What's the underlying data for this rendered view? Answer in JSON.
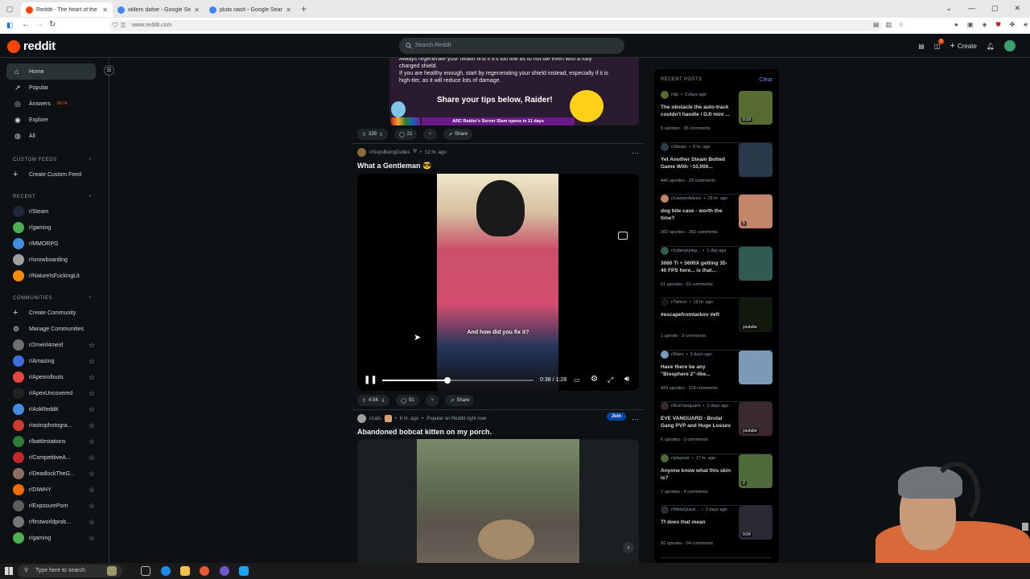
{
  "browser": {
    "tabs": [
      {
        "title": "Reddit - The heart of the in",
        "color": "#ff4500"
      },
      {
        "title": "willem dafoe - Google Search",
        "color": "#4285f4"
      },
      {
        "title": "pluto nash - Google Search",
        "color": "#4285f4"
      }
    ],
    "url": "www.reddit.com"
  },
  "header": {
    "logo": "reddit",
    "search_placeholder": "Search Reddit",
    "create_label": "Create",
    "notif_count": "1"
  },
  "sidebar": {
    "nav": [
      {
        "label": "Home"
      },
      {
        "label": "Popular"
      },
      {
        "label": "Answers",
        "badge": "BETA"
      },
      {
        "label": "Explore"
      },
      {
        "label": "All"
      }
    ],
    "custom_feeds_title": "CUSTOM FEEDS",
    "create_feed": "Create Custom Feed",
    "recent_title": "RECENT",
    "recent": [
      {
        "label": "r/Steam",
        "color": "#1b2838"
      },
      {
        "label": "r/gaming",
        "color": "#4caf50"
      },
      {
        "label": "r/MMORPG",
        "color": "#3f8ee0"
      },
      {
        "label": "r/snowboarding",
        "color": "#9e9e9e"
      },
      {
        "label": "r/NatureIsFuckingLit",
        "color": "#ff8c00"
      }
    ],
    "communities_title": "COMMUNITIES",
    "create_community": "Create Community",
    "manage_communities": "Manage Communities",
    "communities": [
      {
        "label": "r/2meirl4meirl",
        "color": "#6e6e6e"
      },
      {
        "label": "r/Amazing",
        "color": "#3d6ee0"
      },
      {
        "label": "r/Apexrollouts",
        "color": "#e8453c"
      },
      {
        "label": "r/ApexUncovered",
        "color": "#222"
      },
      {
        "label": "r/AskReddit",
        "color": "#3f8ee0"
      },
      {
        "label": "r/astrophotogra...",
        "color": "#cc3b2b"
      },
      {
        "label": "r/battlestations",
        "color": "#2e7d32"
      },
      {
        "label": "r/CompetitiveA...",
        "color": "#c62828"
      },
      {
        "label": "r/DeadlockTheG...",
        "color": "#8d6e63"
      },
      {
        "label": "r/DIWHY",
        "color": "#ef6c00"
      },
      {
        "label": "r/ExposurePorn",
        "color": "#5d5d5d"
      },
      {
        "label": "r/firstworldprob...",
        "color": "#777"
      },
      {
        "label": "r/gaming",
        "color": "#4caf50"
      }
    ]
  },
  "feed": {
    "banner": {
      "line1": "Always regenerate your health first if it's too low as to not die even with a fully charged shield.",
      "line2": "If you are healthy enough, start by regenerating your shield instead, especially if it is high-tier, as it will reduce lots of damage.",
      "cta": "Share your tips below, Raider!",
      "footer": "ARC Raider's Server Slam opens in 11 days"
    },
    "post0": {
      "upvotes": "339",
      "comments": "21",
      "share": "Share"
    },
    "post1": {
      "subreddit": "r/GuysBeingDudes",
      "time": "12 hr. ago",
      "title": "What a Gentleman 😎",
      "caption": "And how did you fix it?",
      "time_display": "0:38 / 1:28",
      "progress": 0.43,
      "upvotes": "4.5K",
      "comments": "91",
      "share": "Share"
    },
    "post2": {
      "subreddit": "r/cats",
      "time": "6 hr. ago",
      "popular": "Popular on Reddit right now",
      "join": "Join",
      "title": "Abandoned bobcat kitten on my porch."
    }
  },
  "recent_posts": {
    "title": "RECENT POSTS",
    "clear": "Clear",
    "items": [
      {
        "sub": "r/dji",
        "time": "3 days ago",
        "title": "The obstacle the auto-track couldn't handle / DJI mini ...",
        "upvotes": "5 upvotes",
        "comments": "36 comments",
        "thumb": "#556b2f",
        "badge": "0:19"
      },
      {
        "sub": "r/Steam",
        "time": "6 hr. ago",
        "title": "Yet Another Steam Botted Game With ~10,000...",
        "upvotes": "446 upvotes",
        "comments": "29 comments",
        "thumb": "#2a3a4a",
        "badge": ""
      },
      {
        "sub": "r/LawyerAdvice",
        "time": "18 hr. ago",
        "title": "dog bite case - worth the time?",
        "upvotes": "282 upvotes",
        "comments": "262 comments",
        "thumb": "#c4866a",
        "badge": "5"
      },
      {
        "sub": "r/cyberpunkg...",
        "time": "1 day ago",
        "title": "3060 Ti + 5600X getting 35-40 FPS here... is that...",
        "upvotes": "61 upvotes",
        "comments": "61 comments",
        "thumb": "#2f5b52",
        "badge": ""
      },
      {
        "sub": "r/Tarkov",
        "time": "19 hr. ago",
        "title": "#escapefromtarkov #eft",
        "upvotes": "1 upvote",
        "comments": "3 comments",
        "thumb": "#121a0f",
        "badge": "youtube"
      },
      {
        "sub": "r/Mars",
        "time": "3 days ago",
        "title": "Have there be any \"Biosphere 2\"-like...",
        "upvotes": "429 upvotes",
        "comments": "119 comments",
        "thumb": "#7a9ab8",
        "badge": ""
      },
      {
        "sub": "r/EveVanguard",
        "time": "2 days ago",
        "title": "EVE VANGUARD - Brutal Gang PVP and Huge Losses",
        "upvotes": "6 upvotes",
        "comments": "3 comments",
        "thumb": "#3a2a30",
        "badge": "youtube"
      },
      {
        "sub": "r/playrust",
        "time": "17 hr. ago",
        "title": "Anyone know what this skin is?",
        "upvotes": "7 upvotes",
        "comments": "4 comments",
        "thumb": "#4f6a3a",
        "badge": "2"
      },
      {
        "sub": "r/MetaQuest...",
        "time": "2 days ago",
        "title": "Tf does that mean",
        "upvotes": "92 upvotes",
        "comments": "64 comments",
        "thumb": "#2a2a35",
        "badge": "0:04"
      }
    ]
  },
  "taskbar": {
    "search_placeholder": "Type here to search"
  }
}
